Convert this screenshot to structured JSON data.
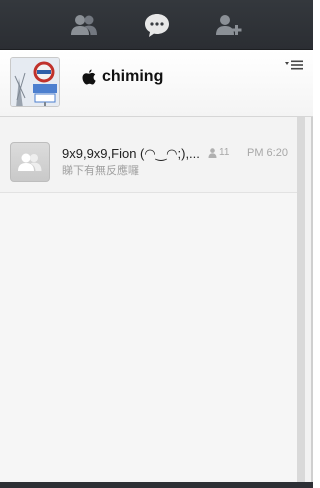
{
  "topbar": {
    "tabs": [
      {
        "icon": "friends-icon"
      },
      {
        "icon": "chat-bubble-icon",
        "active": true
      },
      {
        "icon": "add-friend-icon"
      }
    ]
  },
  "profile": {
    "name": "chiming",
    "brand_icon": "apple-icon",
    "menu_icon": "menu-dropdown-icon"
  },
  "chats": [
    {
      "title": "9x9,9x9,Fion (◠‿◠;),...",
      "member_count": "11",
      "time": "PM 6:20",
      "preview": "睇下有無反應囉"
    }
  ],
  "colors": {
    "topbar": "#2f3237",
    "list_bg": "#f3f3f3",
    "muted_text": "#a7a7a7"
  }
}
